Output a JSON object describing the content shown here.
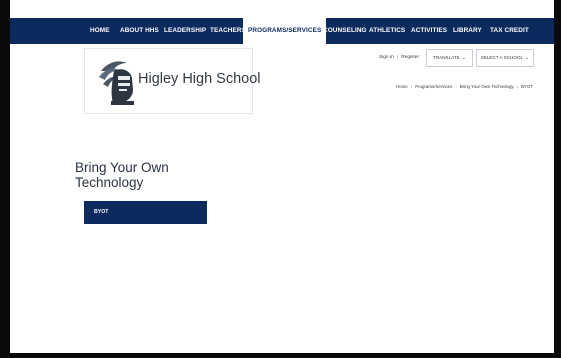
{
  "nav": {
    "items": [
      {
        "label": "HOME",
        "active": false
      },
      {
        "label": "ABOUT HHS",
        "active": false
      },
      {
        "label": "LEADERSHIP",
        "active": false
      },
      {
        "label": "TEACHERS",
        "active": false
      },
      {
        "label": "PROGRAMS/SERVICES",
        "active": true
      },
      {
        "label": "COUNSELING",
        "active": false
      },
      {
        "label": "ATHLETICS",
        "active": false
      },
      {
        "label": "ACTIVITIES",
        "active": false
      },
      {
        "label": "LIBRARY",
        "active": false
      },
      {
        "label": "TAX CREDIT",
        "active": false
      }
    ]
  },
  "header": {
    "school_name": "Higley High School",
    "logo_icon": "knight-helmet-icon",
    "sign_in": "Sign In",
    "register": "Register",
    "separator": "|",
    "translate": "TRANSLATE",
    "select_school": "SELECT A SCHOOL",
    "chevron": "⌄"
  },
  "breadcrumb": {
    "items": [
      "Home",
      "Programs/Services",
      "Bring Your Own Technology",
      "BYOT"
    ],
    "separator": "›"
  },
  "main": {
    "title": "Bring Your Own Technology",
    "side_nav": [
      {
        "label": "BYOT"
      }
    ]
  },
  "colors": {
    "nav_bg": "#0c2a5e",
    "text": "#2a3340",
    "frame": "#0a0a0a"
  }
}
